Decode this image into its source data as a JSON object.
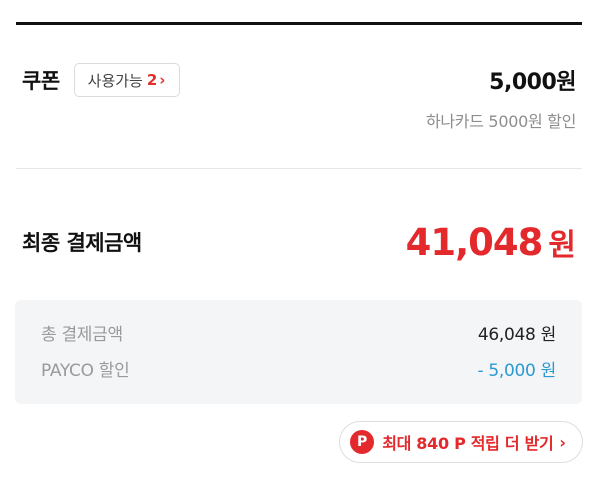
{
  "coupon": {
    "title": "쿠폰",
    "available_label": "사용가능",
    "available_count": "2",
    "chevron_icon": "chevron-right-icon",
    "amount": "5,000원",
    "note": "하나카드 5000원 할인"
  },
  "final": {
    "label": "최종 결제금액",
    "amount": "41,048",
    "unit": "원",
    "color": "#e3292b"
  },
  "summary": {
    "rows": [
      {
        "label": "총 결제금액",
        "value": "46,048 원"
      },
      {
        "label": "PAYCO 할인",
        "value": "- 5,000 원"
      }
    ],
    "discount_color": "#2b9ad2"
  },
  "points": {
    "icon_glyph": "P",
    "icon": "payco-point-icon",
    "text": "최대 840 P 적립 더 받기",
    "chevron": "›"
  }
}
